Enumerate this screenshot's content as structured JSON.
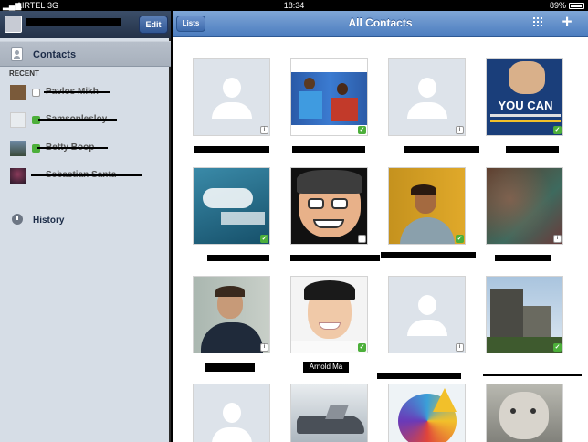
{
  "status_bar": {
    "carrier": "AIRTEL",
    "network": "3G",
    "time": "18:34",
    "battery": "89%"
  },
  "sidebar": {
    "edit_label": "Edit",
    "contacts_label": "Contacts",
    "recent_label": "RECENT",
    "recent_items": [
      {
        "name": "Pavlos Mikh"
      },
      {
        "name": "Samsonlesloy"
      },
      {
        "name": "Betty Boop"
      },
      {
        "name": "Sebastian Santa"
      }
    ],
    "history_label": "History"
  },
  "main": {
    "lists_label": "Lists",
    "title": "All Contacts",
    "visible_name": "Arnold Ma"
  },
  "colors": {
    "header_blue": "#4d7ec0",
    "sidebar_bg": "#d6dde6",
    "check_green": "#4caf3a"
  },
  "icons": {
    "dialpad": "keypad-grid-icon",
    "add": "plus-icon",
    "history": "clock-icon",
    "contacts": "address-book-icon"
  }
}
